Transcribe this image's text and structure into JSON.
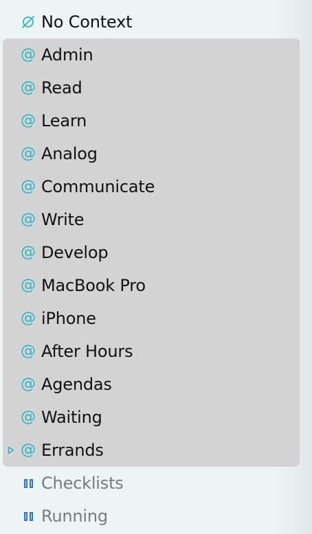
{
  "sidebar": {
    "no_context": {
      "label": "No Context",
      "icon": "no-context-icon"
    },
    "context_icon": "@",
    "contexts": [
      {
        "label": "Admin"
      },
      {
        "label": "Read"
      },
      {
        "label": "Learn"
      },
      {
        "label": "Analog"
      },
      {
        "label": "Communicate"
      },
      {
        "label": "Write"
      },
      {
        "label": "Develop"
      },
      {
        "label": "MacBook Pro"
      },
      {
        "label": "iPhone"
      },
      {
        "label": "After Hours"
      },
      {
        "label": "Agendas"
      },
      {
        "label": "Waiting"
      },
      {
        "label": "Errands",
        "collapsed": true
      }
    ],
    "perspectives": [
      {
        "label": "Checklists",
        "icon": "perspective-icon"
      },
      {
        "label": "Running",
        "icon": "perspective-icon"
      }
    ]
  },
  "colors": {
    "context_icon": "#27b8c4",
    "perspective_icon": "#2b73d6",
    "selection": "#d3d3d3",
    "background": "#eef3f3"
  }
}
